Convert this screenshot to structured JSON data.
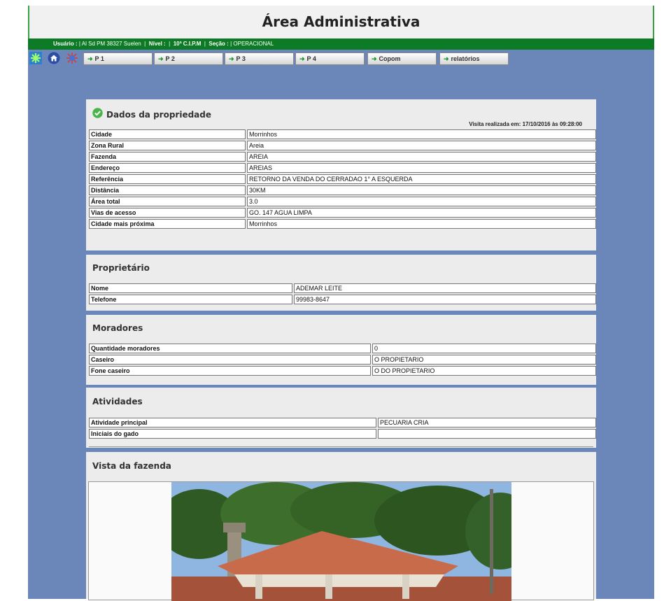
{
  "header": {
    "title": "Área Administrativa"
  },
  "userbar": {
    "usuario_label": "Usuário :",
    "usuario_value": "| Al Sd PM 38327 Suelen",
    "nivel_label": "Nível :",
    "nivel_value": "|",
    "cipm": "10ª C.I.P.M",
    "secao_label": "Seção :",
    "secao_value": "| OPERACIONAL"
  },
  "toolbar": {
    "icons": [
      "asterisk-icon",
      "home-icon",
      "sun-icon"
    ],
    "buttons": [
      "P 1",
      "P 2",
      "P 3",
      "P 4",
      "Copom",
      "relatórios"
    ]
  },
  "propriedade": {
    "title": "Dados da propriedade",
    "visit": "Visita realizada em: 17/10/2016 às 09:28:00",
    "rows": [
      {
        "label": "Cidade",
        "value": "Morrinhos"
      },
      {
        "label": "Zona Rural",
        "value": "Areia"
      },
      {
        "label": "Fazenda",
        "value": "AREIA"
      },
      {
        "label": "Endereço",
        "value": "AREIAS"
      },
      {
        "label": "Referência",
        "value": "RETORNO DA VENDA DO CERRADAO 1° A ESQUERDA"
      },
      {
        "label": "Distância",
        "value": "30KM"
      },
      {
        "label": "Área total",
        "value": "3.0"
      },
      {
        "label": "Vias de acesso",
        "value": "GO. 147 AGUA LIMPA"
      },
      {
        "label": "Cidade mais próxima",
        "value": "Morrinhos"
      }
    ]
  },
  "proprietario": {
    "title": "Proprietário",
    "rows": [
      {
        "label": "Nome",
        "value": "ADEMAR LEITE"
      },
      {
        "label": "Telefone",
        "value": "99983-8647"
      }
    ]
  },
  "moradores": {
    "title": "Moradores",
    "rows": [
      {
        "label": "Quantidade moradores",
        "value": "0"
      },
      {
        "label": "Caseiro",
        "value": "O PROPIETARIO"
      },
      {
        "label": "Fone caseiro",
        "value": "O DO PROPIETARIO"
      }
    ]
  },
  "atividades": {
    "title": "Atividades",
    "rows": [
      {
        "label": "Atividade principal",
        "value": "PECUARIA CRIA"
      },
      {
        "label": "Iniciais do gado",
        "value": ""
      }
    ]
  },
  "vista": {
    "title": "Vista da fazenda"
  },
  "colors": {
    "frame": "#6b86b8",
    "userbar": "#0d7a25",
    "panel": "#ececec",
    "accent": "#1b9a2b"
  }
}
